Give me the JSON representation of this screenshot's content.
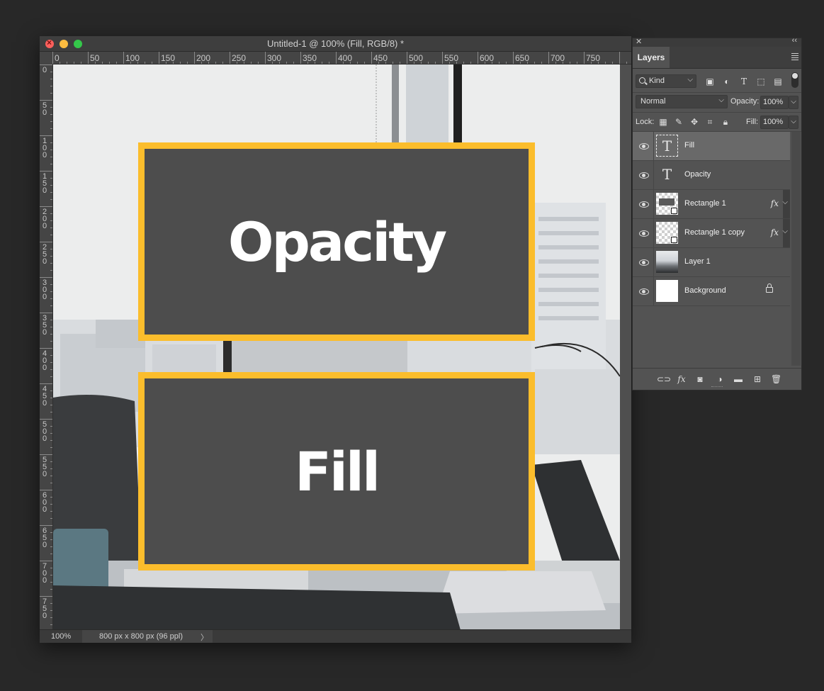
{
  "document": {
    "title": "Untitled-1 @ 100% (Fill, RGB/8) *",
    "zoom": "100%",
    "info": "800 px x 800 px (96 ppl)",
    "ruler_h": [
      "0",
      "50",
      "100",
      "150",
      "200",
      "250",
      "300",
      "350",
      "400",
      "450",
      "500",
      "550",
      "600",
      "650",
      "700",
      "750"
    ],
    "ruler_v": [
      "0",
      "50",
      "100",
      "150",
      "200",
      "250",
      "300",
      "350",
      "400",
      "450",
      "500",
      "550",
      "600",
      "650",
      "700",
      "750"
    ]
  },
  "canvas": {
    "panel_top_text": "Opacity",
    "panel_bottom_text": "Fill",
    "accent_color": "#fbbd2c",
    "panel_color": "#4d4d4d"
  },
  "layers_panel": {
    "tab_label": "Layers",
    "filter_kind": "Kind",
    "blend_mode": "Normal",
    "opacity_label": "Opacity:",
    "opacity_value": "100%",
    "lock_label": "Lock:",
    "fill_label": "Fill:",
    "fill_value": "100%",
    "layers": [
      {
        "name": "Fill",
        "type": "text",
        "selected": true
      },
      {
        "name": "Opacity",
        "type": "text"
      },
      {
        "name": "Rectangle 1",
        "type": "shape",
        "fx": "fx"
      },
      {
        "name": "Rectangle 1 copy",
        "type": "shape",
        "fx": "fx"
      },
      {
        "name": "Layer 1",
        "type": "photo"
      },
      {
        "name": "Background",
        "type": "background",
        "locked": true
      }
    ],
    "icons": {
      "filter": [
        "image-filter-icon",
        "adjustment-filter-icon",
        "type-filter-icon",
        "shape-filter-icon",
        "smart-object-filter-icon"
      ],
      "lock": [
        "lock-transparent-icon",
        "lock-brush-icon",
        "lock-position-icon",
        "lock-artboard-icon",
        "lock-all-icon"
      ],
      "bottom": [
        "link-icon",
        "fx-icon",
        "mask-icon",
        "adjustment-icon",
        "folder-icon",
        "new-layer-icon",
        "trash-icon"
      ]
    }
  }
}
